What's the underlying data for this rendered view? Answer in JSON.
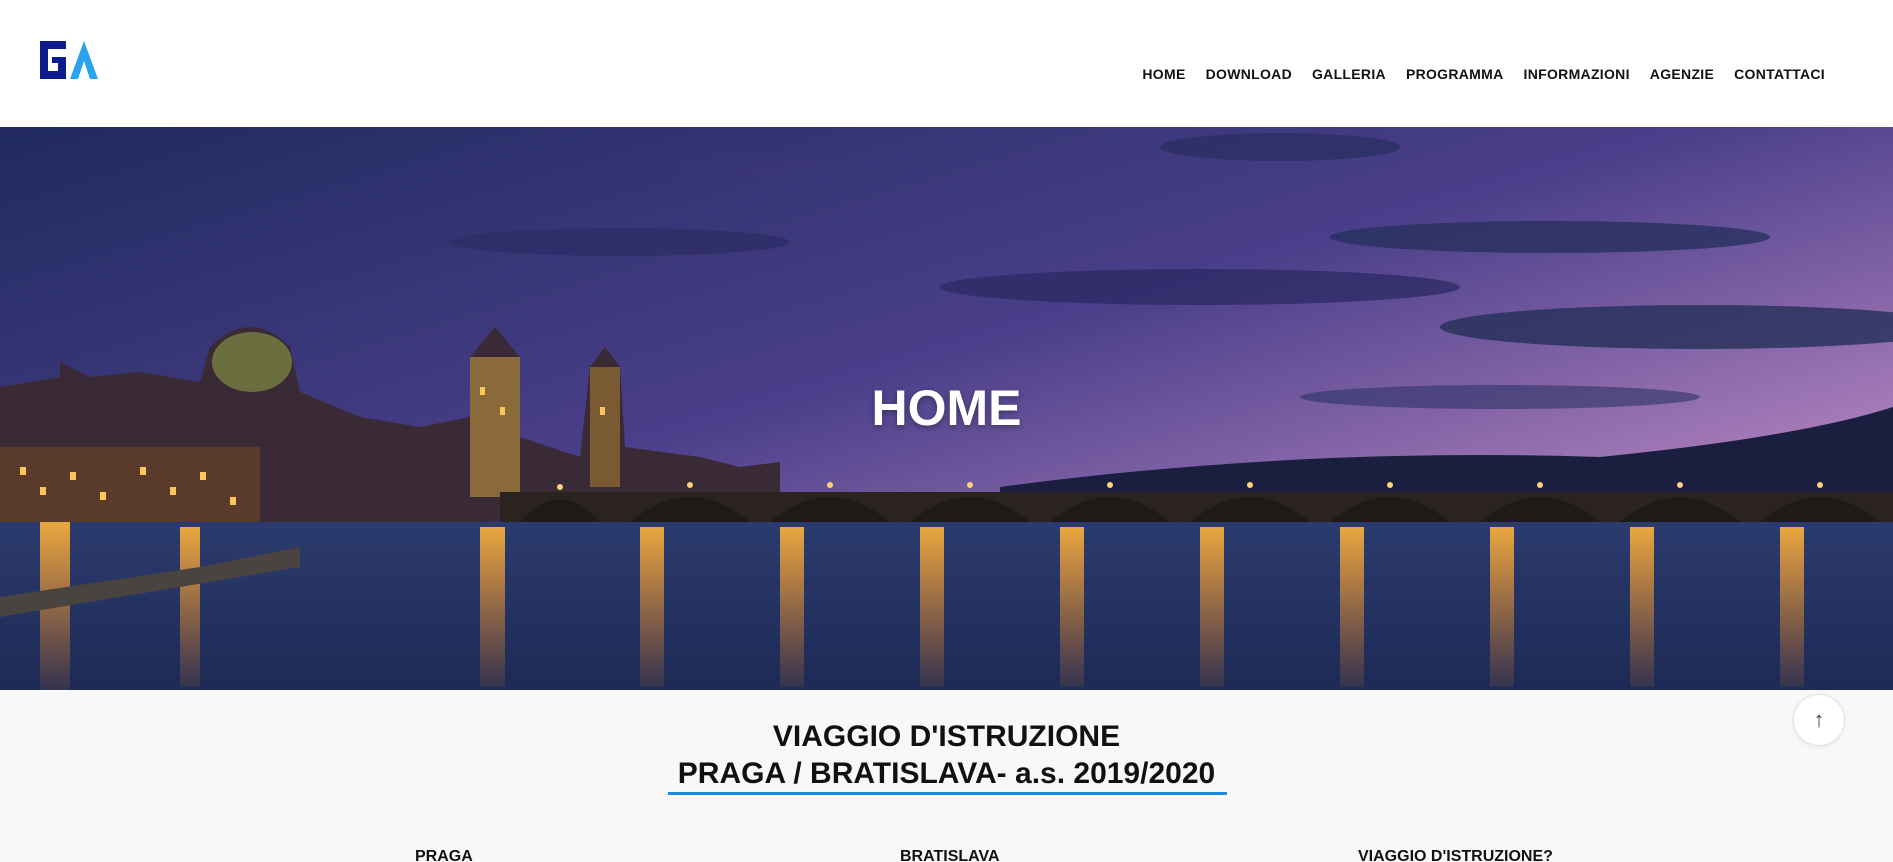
{
  "header": {
    "logo_icon": "ga-logo-icon",
    "nav": [
      {
        "label": "HOME"
      },
      {
        "label": "DOWNLOAD"
      },
      {
        "label": "GALLERIA"
      },
      {
        "label": "PROGRAMMA"
      },
      {
        "label": "INFORMAZIONI"
      },
      {
        "label": "AGENZIE"
      },
      {
        "label": "CONTATTACI"
      }
    ]
  },
  "hero": {
    "title": "HOME",
    "image": "prague-charles-bridge-night-image"
  },
  "intro": {
    "title_line1": "VIAGGIO D'ISTRUZIONE",
    "title_line2": "PRAGA / BRATISLAVA- a.s. 2019/2020",
    "accent_color": "#1e88e5"
  },
  "columns": [
    {
      "heading": "PRAGA"
    },
    {
      "heading": "BRATISLAVA"
    },
    {
      "heading": "VIAGGIO D'ISTRUZIONE?"
    }
  ],
  "scroll_top": {
    "icon": "arrow-up-icon",
    "glyph": "↑"
  }
}
